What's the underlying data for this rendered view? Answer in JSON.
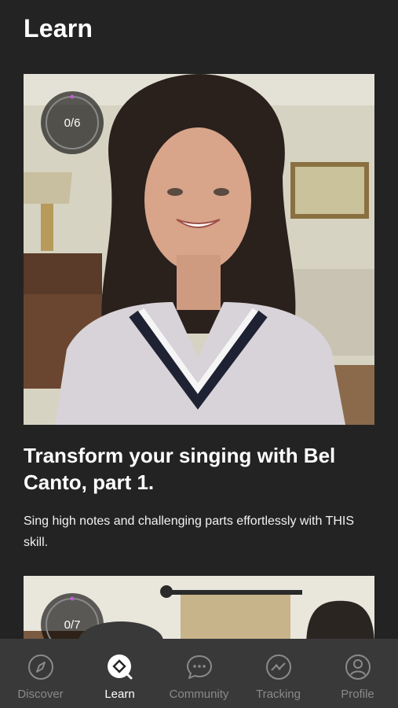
{
  "header": {
    "title": "Learn"
  },
  "cards": [
    {
      "progress": "0/6",
      "progress_fraction": 0,
      "title": "Transform your singing with Bel Canto, part 1.",
      "description": "Sing high notes and challenging parts effortlessly with THIS skill."
    },
    {
      "progress": "0/7",
      "progress_fraction": 0
    }
  ],
  "nav": {
    "items": [
      {
        "label": "Discover",
        "icon": "compass-icon",
        "active": false
      },
      {
        "label": "Learn",
        "icon": "learn-icon",
        "active": true
      },
      {
        "label": "Community",
        "icon": "chat-bubble-icon",
        "active": false
      },
      {
        "label": "Tracking",
        "icon": "tracking-chart-icon",
        "active": false
      },
      {
        "label": "Profile",
        "icon": "profile-icon",
        "active": false
      }
    ]
  },
  "colors": {
    "background": "#232323",
    "nav_background": "#393939",
    "active": "#ffffff",
    "inactive": "#8a8a8a",
    "progress_accent": "#c05bd6"
  }
}
